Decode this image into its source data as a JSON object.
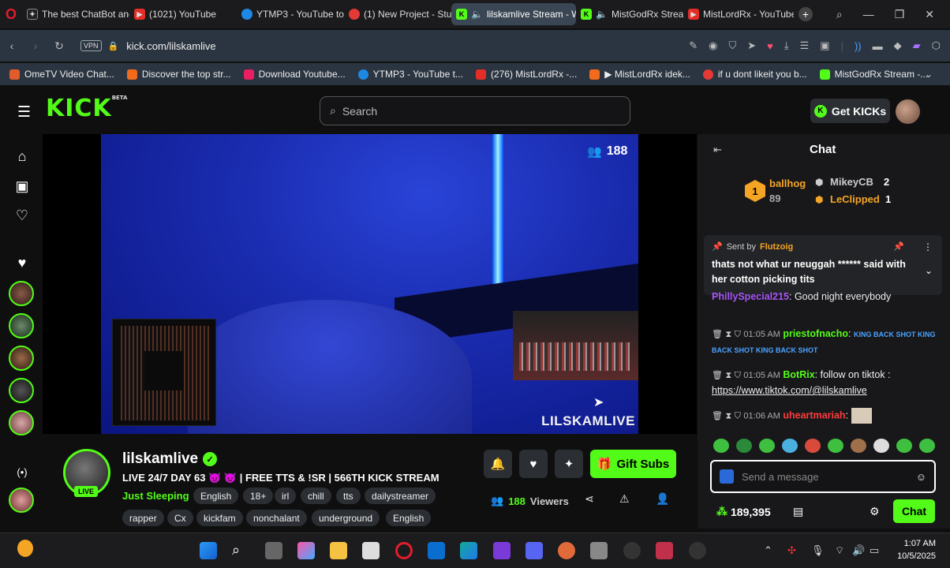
{
  "browser": {
    "tabs": [
      {
        "label": "The best ChatBot and",
        "color": "#222222",
        "icon": "ai-icon"
      },
      {
        "label": "(1021) YouTube",
        "color": "#e52d27",
        "icon": "youtube-icon"
      },
      {
        "label": "YTMP3 - YouTube to",
        "color": "#1e88e5",
        "icon": "ytmp3-icon"
      },
      {
        "label": "(1) New Project - Stu",
        "color": "#e53935",
        "icon": "project-icon"
      },
      {
        "label": "lilskamlive Stream - W",
        "color": "#53fc18",
        "icon": "kick-icon"
      },
      {
        "label": "MistGodRx Stream",
        "color": "#53fc18",
        "icon": "kick-icon"
      },
      {
        "label": "MistLordRx - YouTube",
        "color": "#e52d27",
        "icon": "youtube-icon"
      }
    ],
    "new_tab": "+",
    "url": "kick.com/lilskamlive",
    "vpn": "VPN",
    "bookmarks": [
      {
        "label": "OmeTV Video Chat...",
        "color": "#e25b2b"
      },
      {
        "label": "Discover the top str...",
        "color": "#f26a1b"
      },
      {
        "label": "Download Youtube...",
        "color": "#e91e63"
      },
      {
        "label": "YTMP3 - YouTube t...",
        "color": "#1e88e5"
      },
      {
        "label": "(276) MistLordRx -...",
        "color": "#e52d27"
      },
      {
        "label": "▶ MistLordRx idek...",
        "color": "#f26a1b"
      },
      {
        "label": "if u dont likeit you b...",
        "color": "#e53935"
      },
      {
        "label": "MistGodRx Stream -...",
        "color": "#53fc18"
      }
    ]
  },
  "kick": {
    "logo": "KICK",
    "logo_beta": "BETA",
    "search_placeholder": "Search",
    "get_kicks": "Get KICKs",
    "accent": "#53fc18",
    "viewer_badge": "188",
    "watermark": "LILSKAMLIVE",
    "streamer": {
      "name": "lilskamlive",
      "live": "LIVE",
      "title": "LIVE 24/7 DAY 63 😈 👿 | FREE TTS & !SR | 566TH KICK STREAM",
      "category": "Just Sleeping",
      "tags_row1": [
        "English",
        "18+",
        "irl",
        "chill",
        "tts",
        "dailystreamer"
      ],
      "tags_row2": [
        "rapper",
        "Cx",
        "kickfam",
        "nonchalant",
        "underground",
        "English"
      ]
    },
    "gift_subs": "Gift Subs",
    "viewers_count": "188",
    "viewers_label": "Viewers"
  },
  "chat": {
    "title": "Chat",
    "leaderboard": [
      {
        "rank": "1",
        "name": "ballhog",
        "amount": "89",
        "color": "#f5a524"
      },
      {
        "name": "MikeyCB",
        "amount": "2",
        "color": "#cccccc"
      },
      {
        "name": "LeClipped",
        "amount": "1",
        "color": "#f5a524"
      }
    ],
    "pinned": {
      "sent_by_label": "Sent by",
      "sender": "Flutzoig",
      "message": "thats not what ur neuggah ****** said with her cotton picking tits"
    },
    "messages": [
      {
        "time": "",
        "user": "PhillySpecial215",
        "user_color": "#a855f7",
        "text": "Good night everybody"
      },
      {
        "time": "01:05 AM",
        "user": "priestofnacho",
        "user_color": "#53fc18",
        "text": "KING BACK SHOT KING BACK SHOT KING BACK SHOT"
      },
      {
        "time": "01:05 AM",
        "user": "BotRix",
        "user_color": "#53fc18",
        "text": "follow on tiktok :",
        "link": "https://www.tiktok.com/@lilskamlive"
      },
      {
        "time": "01:06 AM",
        "user": "uheartmariah",
        "user_color": "#ff3b3b",
        "text": ""
      }
    ],
    "send_placeholder": "Send a message",
    "points": "189,395",
    "chat_button": "Chat"
  },
  "taskbar": {
    "time": "1:07 AM",
    "date": "10/5/2025"
  }
}
